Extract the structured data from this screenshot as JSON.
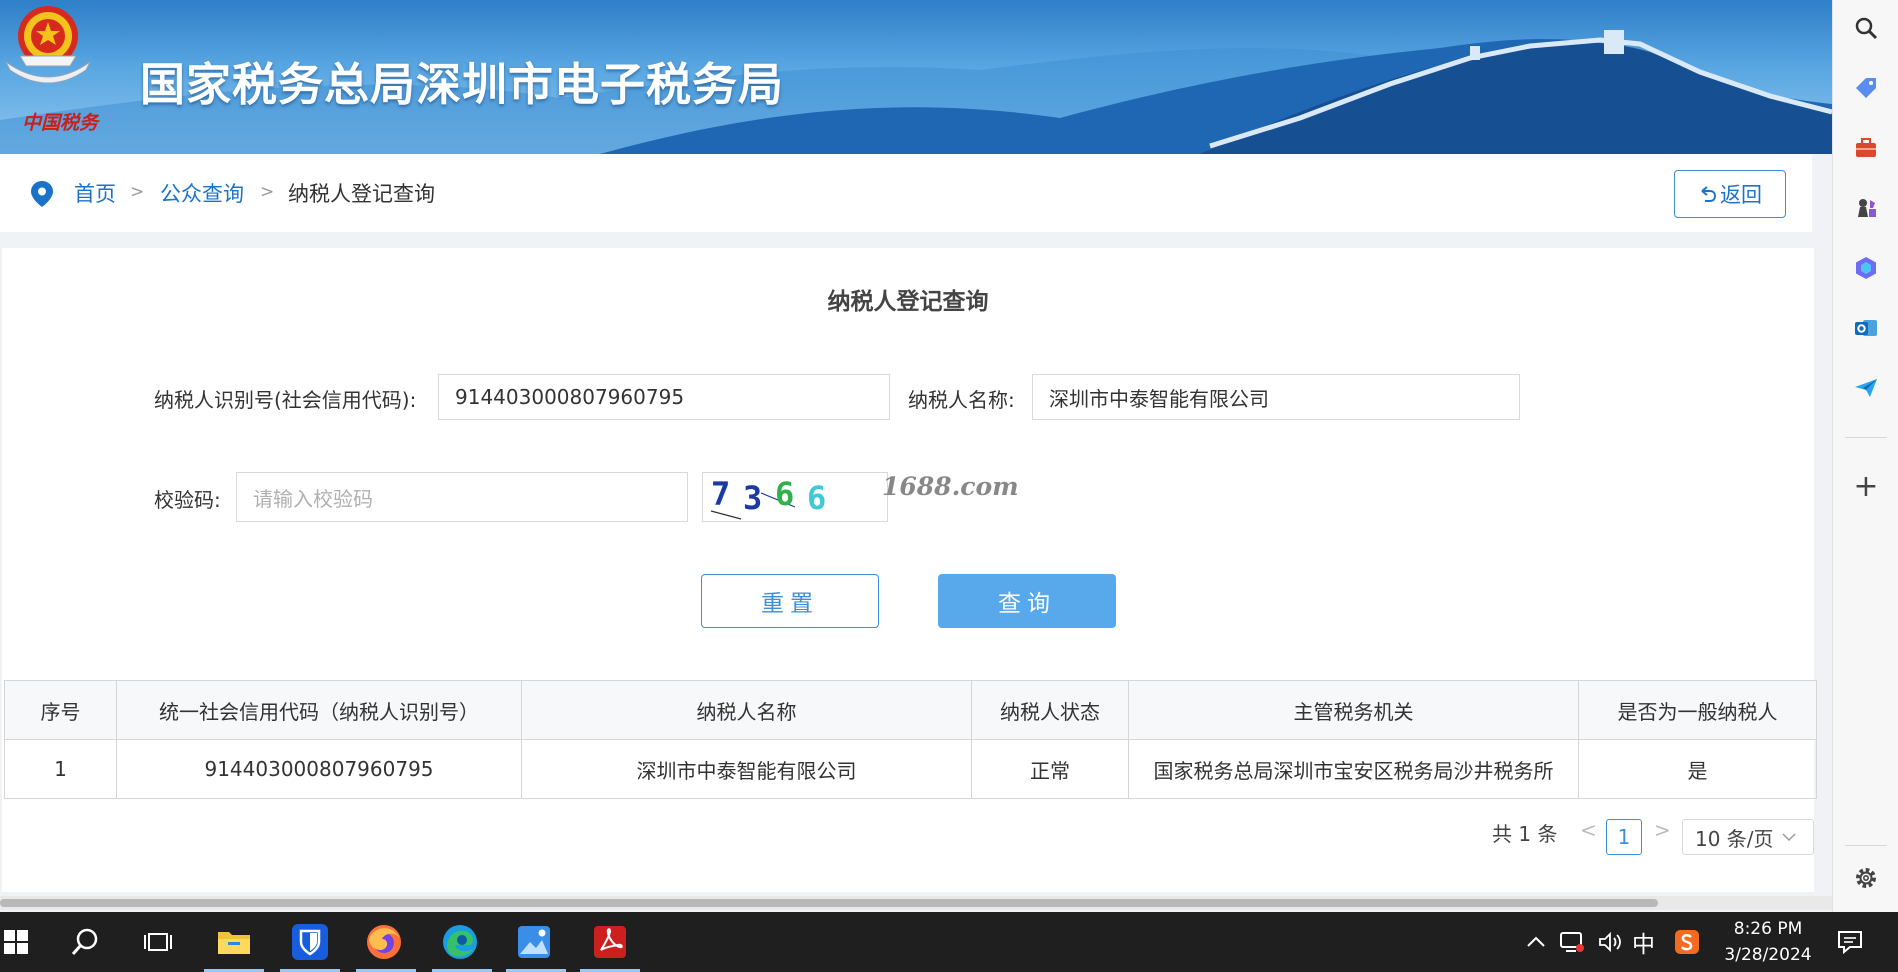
{
  "banner": {
    "title": "国家税务总局深圳市电子税务局",
    "emblem_text": "中国税务"
  },
  "breadcrumb": {
    "home": "首页",
    "public": "公众查询",
    "current": "纳税人登记查询",
    "separator": ">"
  },
  "back_button": {
    "label": "返回"
  },
  "form": {
    "title": "纳税人登记查询",
    "tax_id_label": "纳税人识别号(社会信用代码):",
    "tax_id_value": "914403000807960795",
    "name_label": "纳税人名称:",
    "name_value": "深圳市中泰智能有限公司",
    "captcha_label": "校验码:",
    "captcha_placeholder": "请输入校验码",
    "captcha_chars": [
      "7",
      "3",
      "6",
      "6"
    ],
    "captcha_colors": [
      "#1b3aa8",
      "#1b3aa8",
      "#2fb24a",
      "#3ec8d8"
    ],
    "watermark": "1688.com",
    "reset_label": "重置",
    "query_label": "查询"
  },
  "table": {
    "headers": [
      "序号",
      "统一社会信用代码（纳税人识别号）",
      "纳税人名称",
      "纳税人状态",
      "主管税务机关",
      "是否为一般纳税人"
    ],
    "rows": [
      [
        "1",
        "914403000807960795",
        "深圳市中泰智能有限公司",
        "正常",
        "国家税务总局深圳市宝安区税务局沙井税务所",
        "是"
      ]
    ]
  },
  "pager": {
    "total": "共 1 条",
    "prev": "<",
    "page": "1",
    "next": ">",
    "page_size": "10 条/页"
  },
  "sidebar": {
    "icons": [
      "search-icon",
      "tag-icon",
      "briefcase-icon",
      "chess-icon",
      "copilot-icon",
      "outlook-icon",
      "send-icon",
      "add-icon",
      "settings-icon"
    ],
    "add": "+"
  },
  "taskbar": {
    "apps": [
      "file-explorer-icon",
      "bitwarden-icon",
      "firefox-icon",
      "edge-icon",
      "photos-icon",
      "acrobat-icon"
    ],
    "ime": "中",
    "time": "8:26 PM",
    "date": "3/28/2024"
  },
  "colors": {
    "accent": "#1a73c9",
    "query_button": "#58a8ec",
    "banner_top": "#2f7fc9"
  }
}
